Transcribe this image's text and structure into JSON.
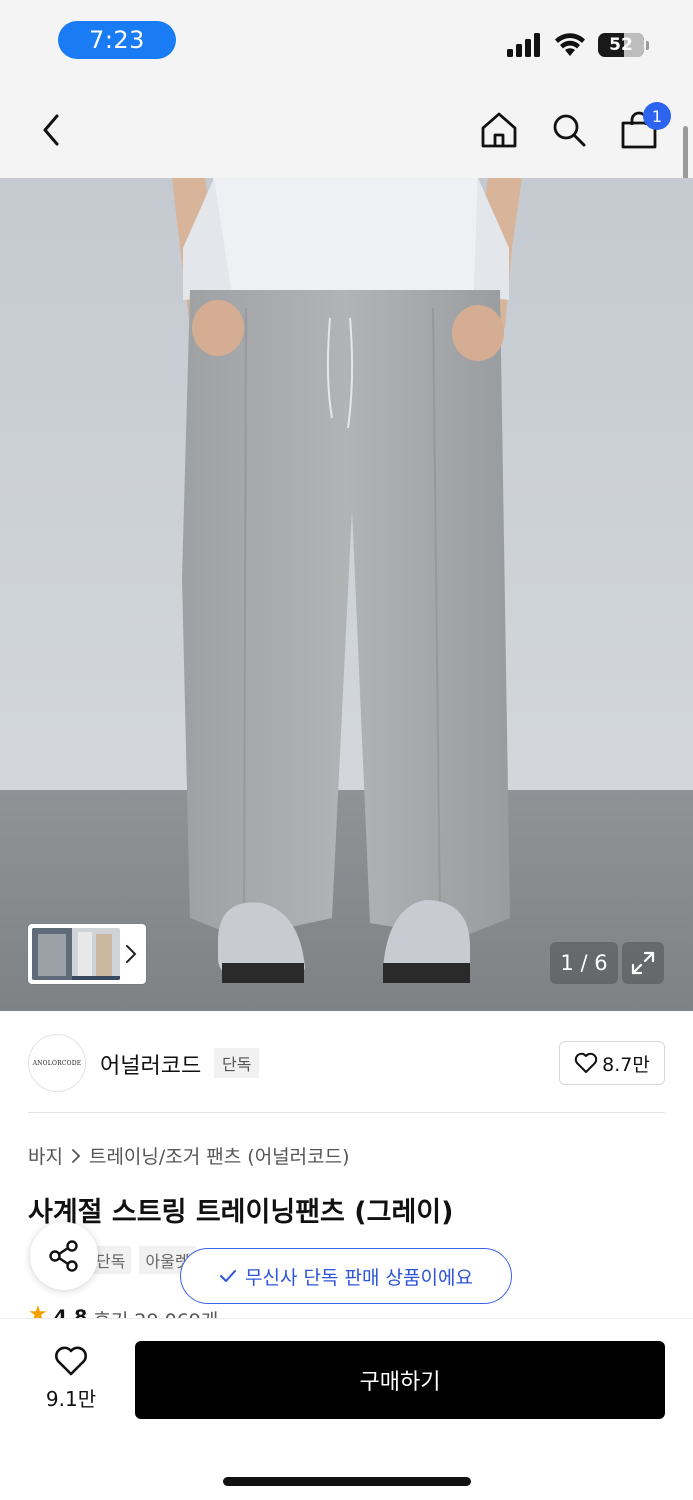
{
  "status_bar": {
    "time": "7:23",
    "battery": "52"
  },
  "nav": {
    "cart_count": "1"
  },
  "gallery": {
    "counter": "1 / 6"
  },
  "brand": {
    "logo_text": "ANOLORCODE",
    "name": "어널러코드",
    "tag": "단독",
    "likes": "8.7만"
  },
  "product": {
    "breadcrumb": [
      "바지",
      "트레이닝/조거 팬츠 (어널러코드)"
    ],
    "title": "사계절 스트링 트레이닝팬츠 (그레이)",
    "tags": [
      "단독",
      "아울렛"
    ],
    "rating": "4.8",
    "reviews": "후기 29,069개"
  },
  "toast": {
    "text": "무신사 단독 판매 상품이에요"
  },
  "bottom": {
    "wish_count": "9.1만",
    "buy_label": "구매하기"
  },
  "colors": {
    "accent": "#2c64f0",
    "toast": "#3b63e8",
    "star": "#f2a100"
  },
  "icons": [
    "back-icon",
    "home-icon",
    "search-icon",
    "cart-icon",
    "expand-icon",
    "heart-icon",
    "share-icon",
    "check-icon",
    "star-icon",
    "chevron-right-icon"
  ]
}
